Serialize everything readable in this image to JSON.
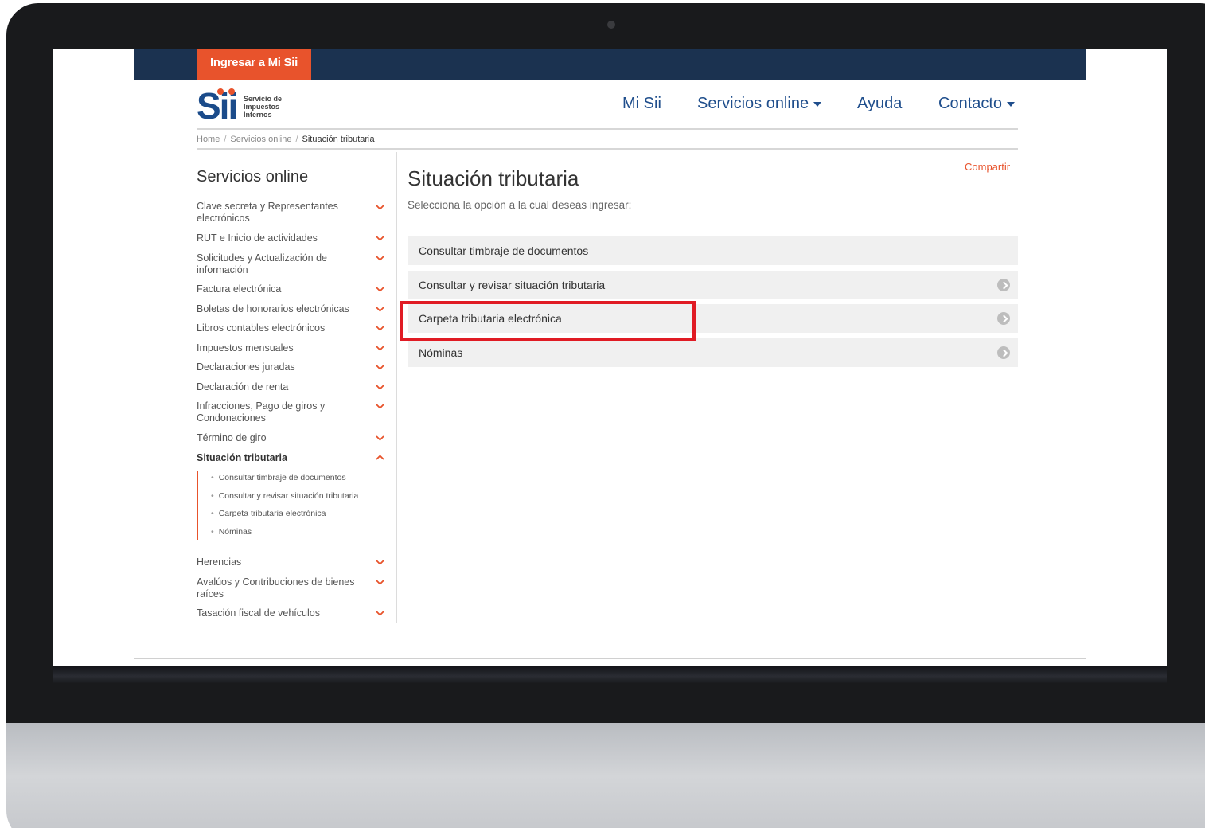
{
  "header": {
    "login_button": "Ingresar a Mi Sii",
    "logo_mark": "Sii",
    "logo_text": "Servicio de Impuestos Internos",
    "nav": [
      {
        "label": "Mi Sii",
        "has_caret": false
      },
      {
        "label": "Servicios online",
        "has_caret": true
      },
      {
        "label": "Ayuda",
        "has_caret": false
      },
      {
        "label": "Contacto",
        "has_caret": true
      }
    ]
  },
  "breadcrumb": [
    "Home",
    "Servicios online",
    "Situación tributaria"
  ],
  "sidebar": {
    "title": "Servicios online",
    "items": [
      {
        "label": "Clave secreta y Representantes electrónicos"
      },
      {
        "label": "RUT e Inicio de actividades"
      },
      {
        "label": "Solicitudes y Actualización de información"
      },
      {
        "label": "Factura electrónica"
      },
      {
        "label": "Boletas de honorarios electrónicas"
      },
      {
        "label": "Libros contables electrónicos"
      },
      {
        "label": "Impuestos mensuales"
      },
      {
        "label": "Declaraciones juradas"
      },
      {
        "label": "Declaración de renta"
      },
      {
        "label": "Infracciones, Pago de giros y Condonaciones"
      },
      {
        "label": "Término de giro"
      },
      {
        "label": "Situación tributaria",
        "expanded": true
      },
      {
        "label": "Herencias"
      },
      {
        "label": "Avalúos y Contribuciones de bienes raíces"
      },
      {
        "label": "Tasación fiscal de vehículos"
      }
    ],
    "subitems": [
      "Consultar timbraje de documentos",
      "Consultar y revisar situación tributaria",
      "Carpeta tributaria electrónica",
      "Nóminas"
    ]
  },
  "main": {
    "title": "Situación tributaria",
    "share": "Compartir",
    "intro": "Selecciona la opción a la cual deseas ingresar:",
    "options": [
      {
        "label": "Consultar timbraje de documentos",
        "icon": false
      },
      {
        "label": "Consultar y revisar situación tributaria",
        "icon": true
      },
      {
        "label": "Carpeta tributaria electrónica",
        "icon": true,
        "highlighted": true
      },
      {
        "label": "Nóminas",
        "icon": true
      }
    ]
  },
  "colors": {
    "brand_navy": "#1b3250",
    "accent_orange": "#e8532c",
    "link_blue": "#1f4e8c",
    "highlight_red": "#e01b24"
  }
}
